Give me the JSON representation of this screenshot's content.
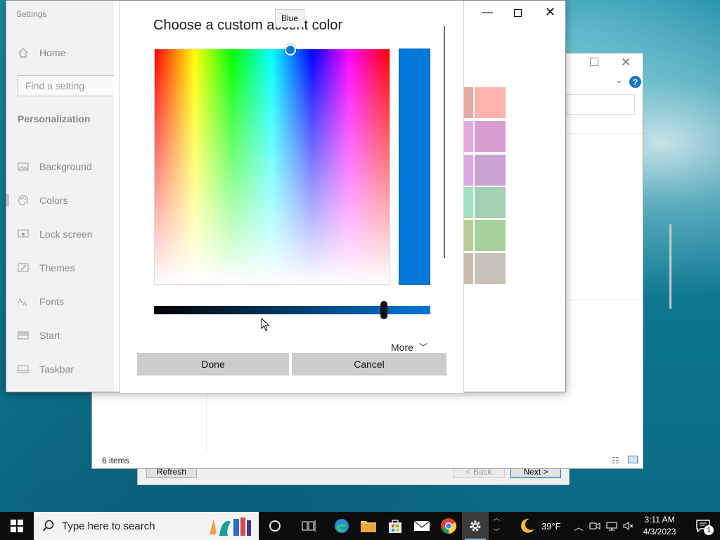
{
  "wizard": {
    "refresh_label": "Refresh",
    "back_label": "< Back",
    "next_label": "Next >"
  },
  "explorer": {
    "status_text": "6 items",
    "close_glyph": "✕",
    "help_glyph": "?"
  },
  "settings": {
    "app_title": "Settings",
    "home_label": "Home",
    "search_placeholder": "Find a setting",
    "section_label": "Personalization",
    "nav": [
      {
        "label": "Background",
        "icon": "image-icon"
      },
      {
        "label": "Colors",
        "icon": "palette-icon"
      },
      {
        "label": "Lock screen",
        "icon": "lock-screen-icon"
      },
      {
        "label": "Themes",
        "icon": "brush-icon"
      },
      {
        "label": "Fonts",
        "icon": "font-icon"
      },
      {
        "label": "Start",
        "icon": "start-icon"
      },
      {
        "label": "Taskbar",
        "icon": "taskbar-icon"
      }
    ],
    "active_nav": "Colors",
    "accent_swatch_colors": [
      "#e8a8a8",
      "#ffb3ae",
      "#e6a7dc",
      "#d99ed1",
      "#dba9e0",
      "#c9a2d2",
      "#9fe0c3",
      "#a3cfb3",
      "#b9cc95",
      "#a4d19c",
      "#c6bdac",
      "#c7c3bb"
    ]
  },
  "dialog": {
    "title": "Choose a custom accent color",
    "tooltip": "Blue",
    "selected_color": "#0078d7",
    "brightness_level": 0.84,
    "more_label": "More",
    "done_label": "Done",
    "cancel_label": "Cancel"
  },
  "taskbar": {
    "search_placeholder": "Type here to search",
    "temperature": "39°F",
    "time": "3:11 AM",
    "date": "4/3/2023",
    "notification_count": "1",
    "pinned": [
      "cortana-icon",
      "task-view-icon",
      "edge-icon",
      "file-explorer-icon",
      "store-icon",
      "mail-icon",
      "chrome-icon",
      "settings-icon"
    ]
  }
}
